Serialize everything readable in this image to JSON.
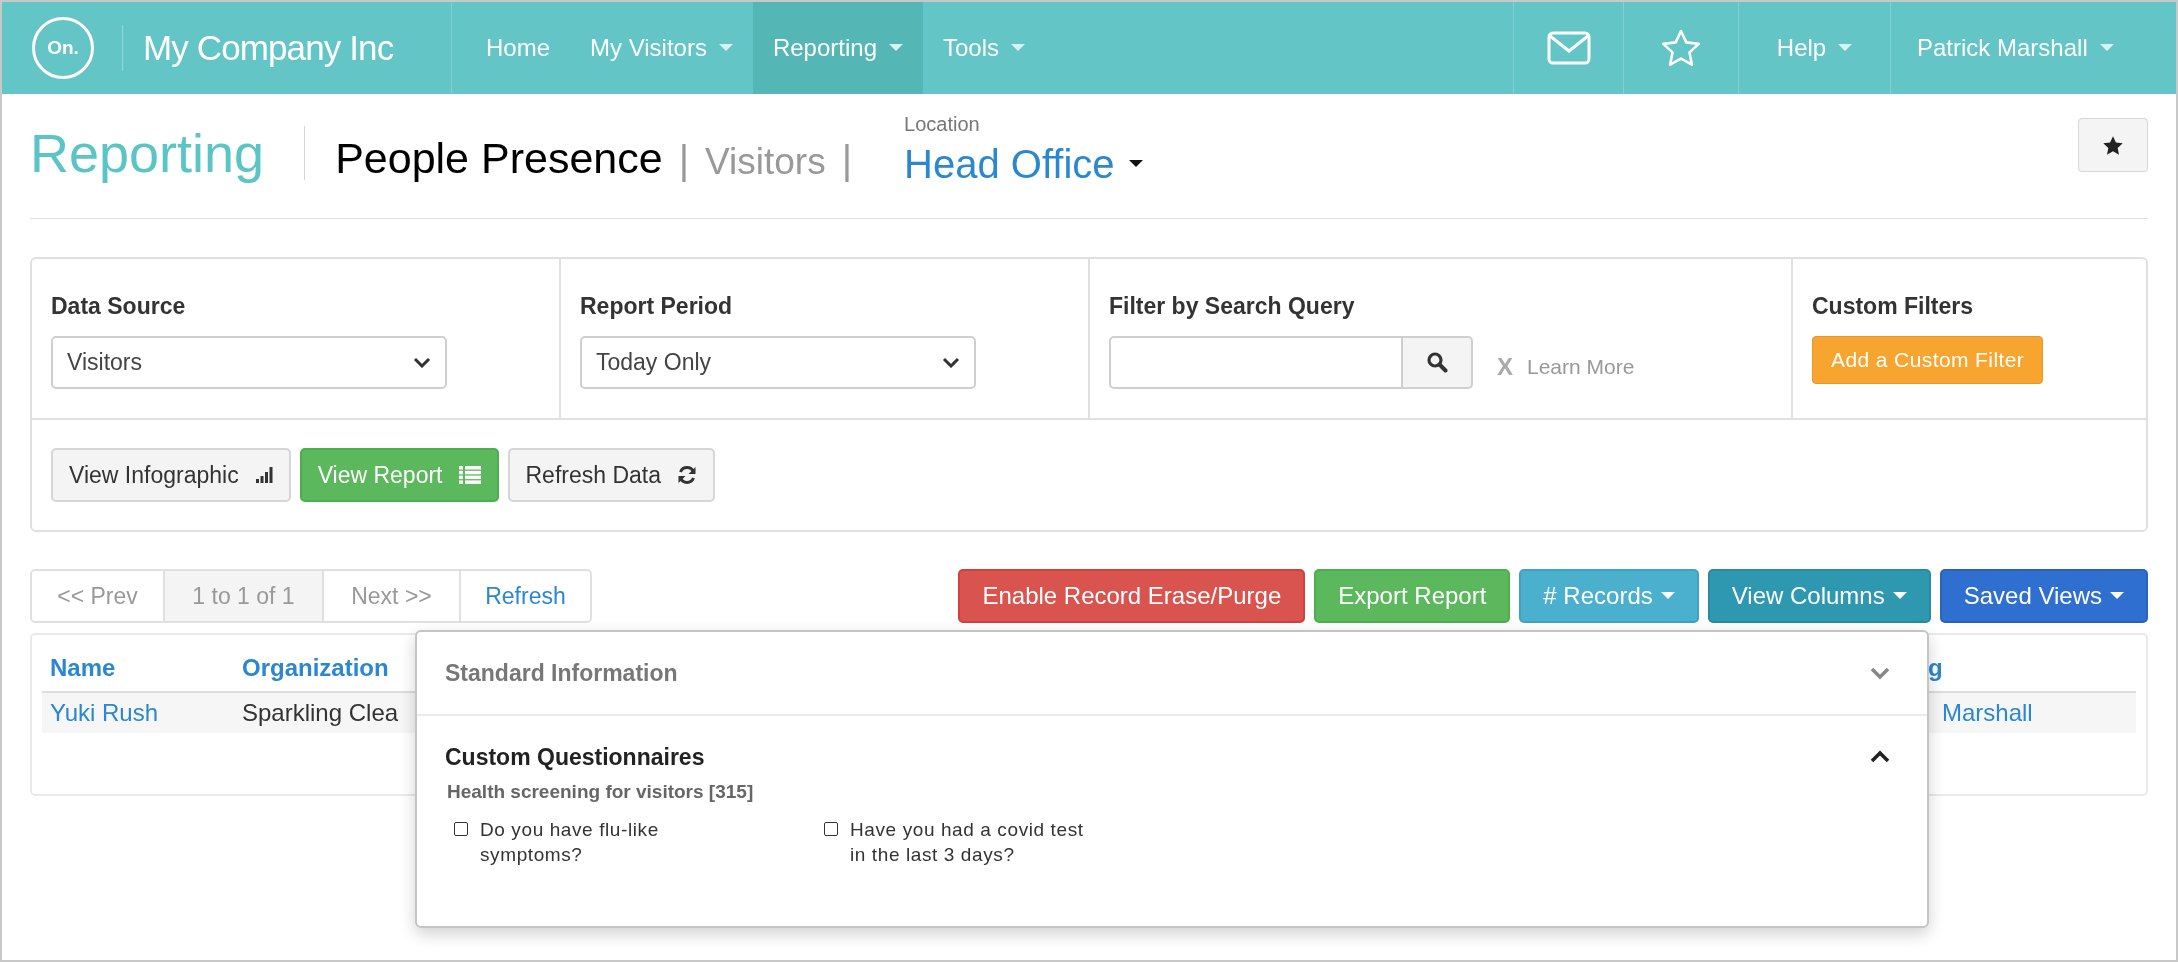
{
  "nav": {
    "logo": "On.",
    "brand": "My Company Inc",
    "items": [
      {
        "label": "Home",
        "dropdown": false,
        "selected": false
      },
      {
        "label": "My Visitors",
        "dropdown": true,
        "selected": false
      },
      {
        "label": "Reporting",
        "dropdown": true,
        "selected": true
      },
      {
        "label": "Tools",
        "dropdown": true,
        "selected": false
      }
    ],
    "menus": [
      {
        "label": "Help",
        "dropdown": true
      },
      {
        "label": "Patrick Marshall",
        "dropdown": true
      }
    ]
  },
  "header": {
    "section": "Reporting",
    "title": "People Presence",
    "separator_1": "|",
    "subtitle": "Visitors",
    "separator_2": "|",
    "location_label": "Location",
    "location": "Head Office"
  },
  "filters": [
    {
      "kind": "select",
      "label": "Data Source",
      "value": "Visitors"
    },
    {
      "kind": "select",
      "label": "Report Period",
      "value": "Today Only"
    },
    {
      "kind": "search",
      "label": "Filter by Search Query",
      "clear": "X",
      "link": "Learn More"
    },
    {
      "kind": "button",
      "label": "Custom Filters",
      "button": "Add a Custom Filter"
    }
  ],
  "actions": [
    {
      "label": "View Infographic",
      "kind": "default"
    },
    {
      "label": "View Report",
      "kind": "success"
    },
    {
      "label": "Refresh Data",
      "kind": "default"
    }
  ],
  "pager": {
    "prev": {
      "label": "<< Prev",
      "disabled": true
    },
    "status": "1 to 1 of 1",
    "next": {
      "label": "Next >>",
      "disabled": true
    },
    "refresh": "Refresh"
  },
  "toolbar": [
    {
      "label": "Enable Record Erase/Purge",
      "kind": "danger",
      "dropdown": false
    },
    {
      "label": "Export Report",
      "kind": "success",
      "dropdown": false
    },
    {
      "label": "# Records",
      "kind": "info",
      "dropdown": true
    },
    {
      "label": "View Columns",
      "kind": "teal",
      "dropdown": true
    },
    {
      "label": "Saved Views",
      "kind": "primary",
      "dropdown": true
    }
  ],
  "table": {
    "columns": [
      "Name",
      "Organization",
      "g"
    ],
    "rows": [
      [
        "Yuki Rush",
        "Sparkling Clea",
        "Marshall"
      ]
    ]
  },
  "columns_menu": {
    "sections": [
      {
        "title": "Standard Information",
        "expanded": false
      },
      {
        "title": "Custom Questionnaires",
        "expanded": true,
        "groups": [
          {
            "title": "Health screening for visitors [315]",
            "options": [
              {
                "label": "Do you have flu-like symptoms?",
                "checked": false
              },
              {
                "label": "Have you had a covid test in the last 3 days?",
                "checked": false
              }
            ]
          }
        ]
      }
    ]
  }
}
